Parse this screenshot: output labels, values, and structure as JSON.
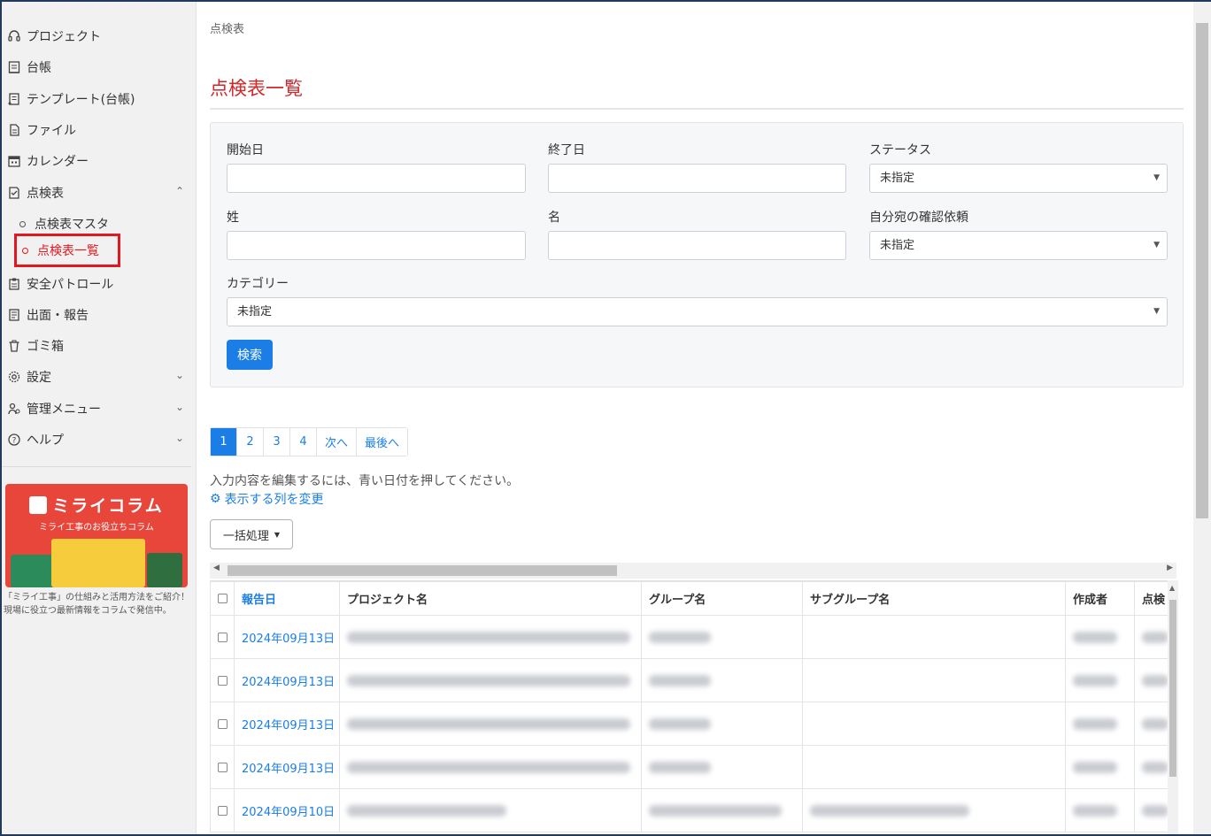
{
  "sidebar": {
    "items": [
      {
        "label": "プロジェクト",
        "icon": "headset-icon"
      },
      {
        "label": "台帳",
        "icon": "ledger-icon"
      },
      {
        "label": "テンプレート(台帳)",
        "icon": "template-icon"
      },
      {
        "label": "ファイル",
        "icon": "file-icon"
      },
      {
        "label": "カレンダー",
        "icon": "calendar-icon"
      },
      {
        "label": "点検表",
        "icon": "checklist-icon"
      },
      {
        "label": "安全パトロール",
        "icon": "patrol-icon"
      },
      {
        "label": "出面・報告",
        "icon": "report-icon"
      },
      {
        "label": "ゴミ箱",
        "icon": "trash-icon"
      },
      {
        "label": "設定",
        "icon": "gear-icon"
      },
      {
        "label": "管理メニュー",
        "icon": "admin-users-icon"
      },
      {
        "label": "ヘルプ",
        "icon": "help-icon"
      }
    ],
    "sub_items": [
      {
        "label": "点検表マスタ"
      },
      {
        "label": "点検表一覧"
      }
    ],
    "banner": {
      "title": "ミライコラム",
      "subtitle": "ミライ工事のお役立ちコラム",
      "description": "「ミライ工事」の仕組みと活用方法をご紹介！現場に役立つ最新情報をコラムで発信中。"
    }
  },
  "breadcrumb": "点検表",
  "page_title": "点検表一覧",
  "filters": {
    "start_date_label": "開始日",
    "end_date_label": "終了日",
    "status_label": "ステータス",
    "status_value": "未指定",
    "last_name_label": "姓",
    "first_name_label": "名",
    "confirm_request_label": "自分宛の確認依頼",
    "confirm_request_value": "未指定",
    "category_label": "カテゴリー",
    "category_value": "未指定",
    "search_label": "検索"
  },
  "pagination": [
    "1",
    "2",
    "3",
    "4",
    "次へ",
    "最後へ"
  ],
  "hint_text": "入力内容を編集するには、青い日付を押してください。",
  "change_columns_label": "表示する列を変更",
  "bulk_action_label": "一括処理",
  "table": {
    "headers": [
      "報告日",
      "プロジェクト名",
      "グループ名",
      "サブグループ名",
      "作成者",
      "点検"
    ],
    "rows": [
      {
        "date": "2024年09月13日"
      },
      {
        "date": "2024年09月13日"
      },
      {
        "date": "2024年09月13日"
      },
      {
        "date": "2024年09月13日"
      },
      {
        "date": "2024年09月10日"
      }
    ]
  },
  "colors": {
    "accent": "#1a7ee6",
    "title_red": "#d3262a",
    "highlight_red": "#e0181f",
    "banner_red": "#e8463a"
  }
}
